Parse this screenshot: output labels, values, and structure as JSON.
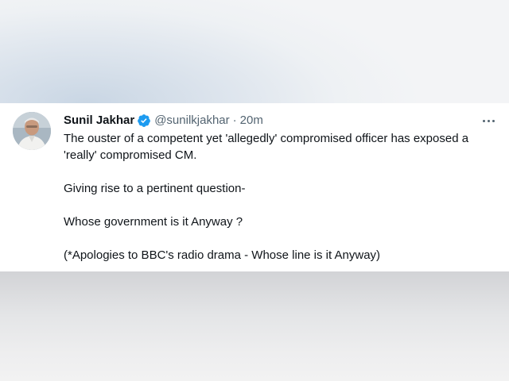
{
  "tweet": {
    "author_name": "Sunil Jakhar",
    "handle": "@sunilkjakhar",
    "separator": "·",
    "time": "20m",
    "paragraphs": [
      "The ouster of a competent yet 'allegedly' compromised officer has exposed a 'really' compromised CM.",
      "Giving rise to a pertinent question-",
      "Whose government is it Anyway ?",
      "(*Apologies to BBC's radio drama - Whose line is it Anyway)"
    ]
  },
  "icons": {
    "verified": "verified-badge-icon",
    "more": "more-options-icon"
  },
  "colors": {
    "verified": "#1d9bf0",
    "text": "#0f1419",
    "secondary_text": "#536471"
  }
}
